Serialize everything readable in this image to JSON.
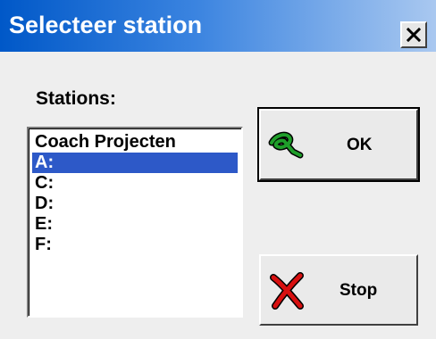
{
  "window": {
    "title": "Selecteer station"
  },
  "title_bar_buttons": {
    "close_icon": "close-icon"
  },
  "stations": {
    "label": "Stations:",
    "items": [
      {
        "label": "Coach Projecten",
        "selected": false
      },
      {
        "label": "A:",
        "selected": true
      },
      {
        "label": "C:",
        "selected": false
      },
      {
        "label": "D:",
        "selected": false
      },
      {
        "label": "E:",
        "selected": false
      },
      {
        "label": "F:",
        "selected": false
      }
    ]
  },
  "buttons": {
    "ok": {
      "label": "OK",
      "icon": "green-check-icon",
      "icon_color": "#1f9e2a"
    },
    "stop": {
      "label": "Stop",
      "icon": "red-x-icon",
      "icon_color": "#d81010"
    }
  },
  "colors": {
    "title_bar_start": "#0058c8",
    "title_bar_end": "#a9c8f0",
    "selection": "#2d59c8"
  }
}
